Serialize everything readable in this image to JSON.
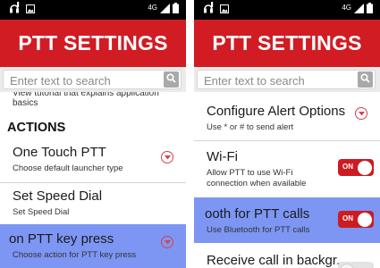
{
  "status_bar": {
    "network_label": "4G",
    "colors": {
      "background": "#000000",
      "icons": "#ffffff"
    }
  },
  "header": {
    "title": "PTT SETTINGS",
    "color": "#d11c24"
  },
  "search": {
    "placeholder": "Enter text to search",
    "button_icon": "search-icon"
  },
  "left_screen": {
    "tutorial_partial": "View tutorial that explains application basics",
    "section_title": "ACTIONS",
    "items": [
      {
        "title": "One Touch PTT",
        "subtitle": "Choose default launcher type",
        "control": "chevron-down-icon"
      },
      {
        "title": "Set Speed Dial",
        "subtitle": "Set Speed Dial"
      },
      {
        "title": "on PTT key press",
        "subtitle": "Choose action for PTT key press",
        "control": "chevron-down-icon",
        "selected": true
      }
    ]
  },
  "right_screen": {
    "items": [
      {
        "title": "Configure Alert Options",
        "subtitle": "Use * or # to send alert",
        "control": "chevron-down-icon"
      },
      {
        "title": "Wi-Fi",
        "subtitle_line1": "Allow PTT to use Wi-Fi",
        "subtitle_line2": "connection when available",
        "toggle": "ON"
      },
      {
        "title": "ooth for PTT calls",
        "subtitle": "Use Bluetooth for PTT calls",
        "toggle": "ON",
        "selected": true
      },
      {
        "title": "Receive call in backgr.."
      }
    ]
  },
  "colors": {
    "selected_row": "#7d96f4",
    "toggle_on": "#cc1c21",
    "chevron": "#d0424d"
  }
}
